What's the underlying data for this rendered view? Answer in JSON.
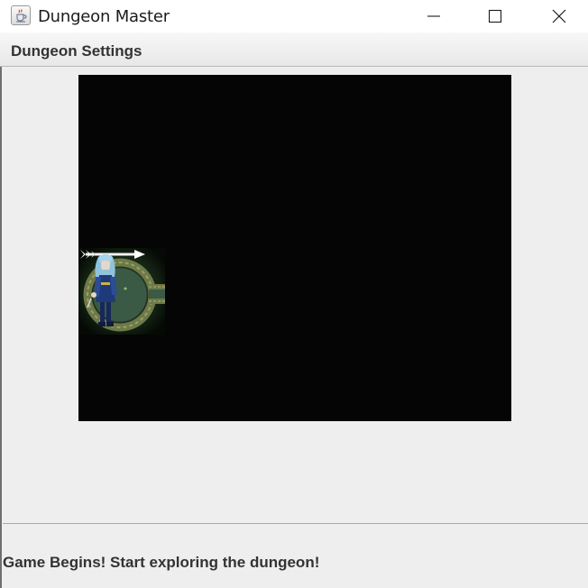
{
  "window": {
    "title": "Dungeon Master",
    "app_icon": "java-cup-icon",
    "controls": [
      "minimize-icon",
      "maximize-icon",
      "close-icon"
    ]
  },
  "menubar": {
    "items": [
      {
        "label": "Dungeon Settings"
      }
    ]
  },
  "game": {
    "background": "#050505",
    "player_tile": {
      "sprite": "blue-haired-swordsman",
      "room": "circular-stone-room",
      "arrow_direction": "east"
    }
  },
  "status": {
    "message": "Game Begins! Start exploring the dungeon!"
  }
}
